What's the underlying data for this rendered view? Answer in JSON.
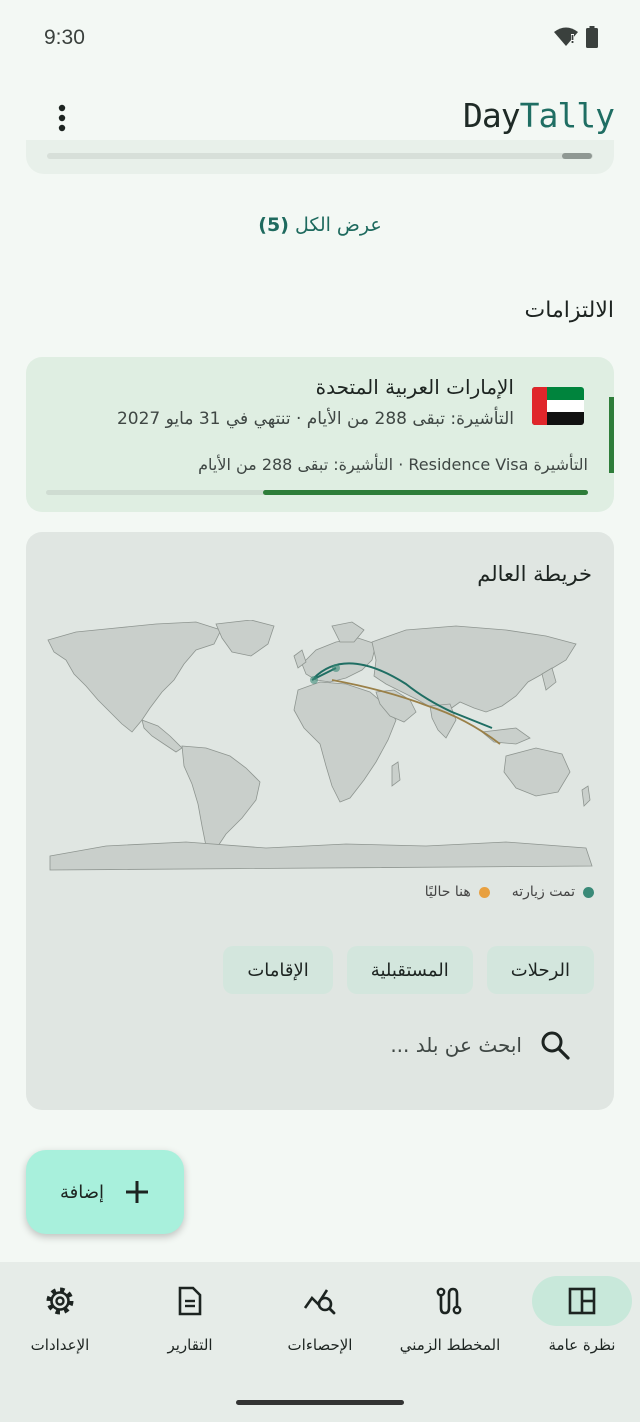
{
  "status": {
    "time": "9:30"
  },
  "app": {
    "title_part1": "Day",
    "title_part2": "Tally",
    "more_icon": "more-vert-icon"
  },
  "visits": {
    "view_all_label": "عرض الكل",
    "view_all_count": "(5)"
  },
  "commitments": {
    "section_title": "الالتزامات",
    "card": {
      "flag": "uae-flag",
      "country": "الإمارات العربية المتحدة",
      "visa_line": "التأشيرة: تبقى 288 من الأيام · تنتهي في 31 مايو 2027",
      "detail_line": "التأشيرة Residence Visa · التأشيرة: تبقى 288 من الأيام",
      "progress": 0.6
    }
  },
  "world_map": {
    "title": "خريطة العالم",
    "legend_visited": "تمت زيارته",
    "legend_current": "هنا حاليًا",
    "visited_color": "#3a8a78",
    "current_color": "#e8a040",
    "chips": [
      "الرحلات",
      "المستقبلية",
      "الإقامات"
    ],
    "search_placeholder": "ابحث عن بلد ..."
  },
  "fab": {
    "label": "إضافة"
  },
  "nav": [
    {
      "label": "نظرة عامة",
      "icon": "overview-icon",
      "active": true
    },
    {
      "label": "المخطط الزمني",
      "icon": "timeline-icon",
      "active": false
    },
    {
      "label": "الإحصاءات",
      "icon": "stats-icon",
      "active": false
    },
    {
      "label": "التقارير",
      "icon": "reports-icon",
      "active": false
    },
    {
      "label": "الإعدادات",
      "icon": "settings-icon",
      "active": false
    }
  ],
  "colors": {
    "accent": "#1f6e63",
    "progress": "#2e7d3a",
    "fab": "#a8f0dc"
  }
}
